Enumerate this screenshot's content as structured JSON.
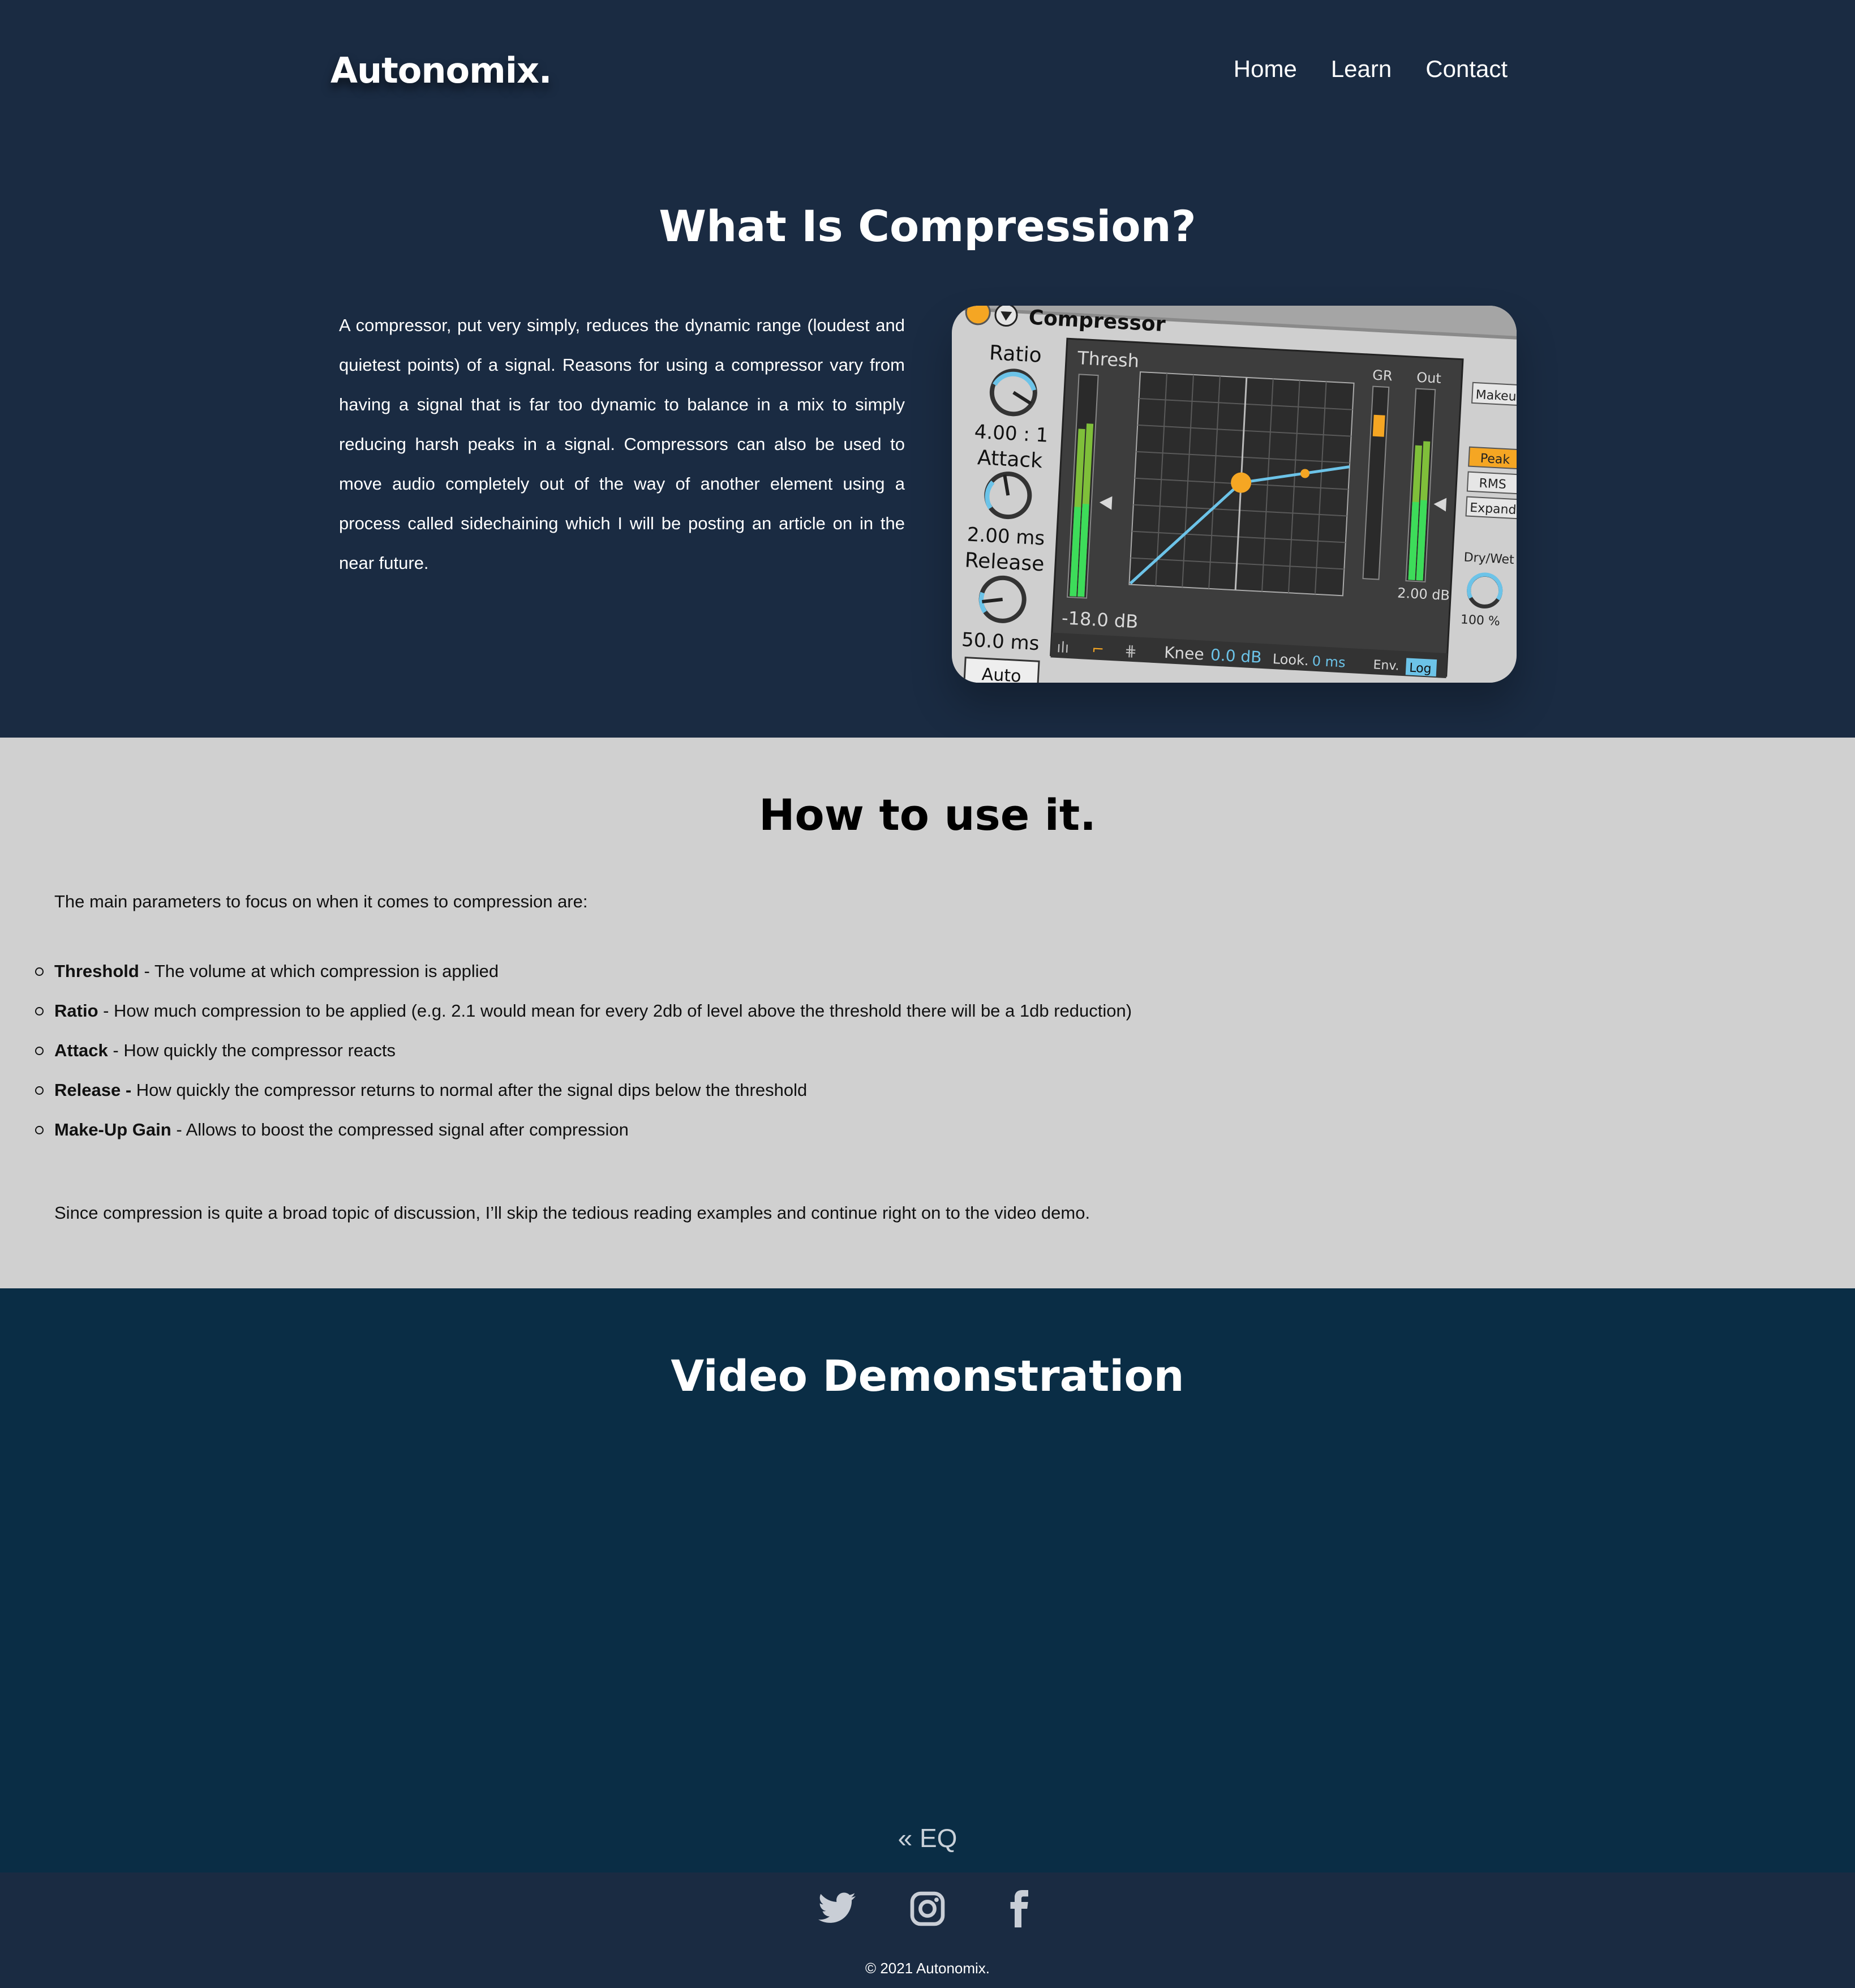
{
  "brand": {
    "logo": "Autonomix."
  },
  "nav": {
    "items": [
      "Home",
      "Learn",
      "Contact"
    ]
  },
  "hero": {
    "title": "What Is Compression?",
    "body": "A compressor, put very simply, reduces the dynamic range (loudest and quietest points) of a signal. Reasons for using a compressor vary from having a signal that is far too dynamic to balance in a mix to simply reducing harsh peaks in a signal. Compressors can also be used to move audio completely out of the way of another element using a process called sidechaining which I will be posting an article on in the near future."
  },
  "plugin": {
    "name": "Compressor",
    "ratio_label": "Ratio",
    "ratio_value": "4.00 : 1",
    "attack_label": "Attack",
    "attack_value": "2.00 ms",
    "release_label": "Release",
    "release_value": "50.0 ms",
    "auto_label": "Auto",
    "thresh_label": "Thresh",
    "thresh_value": "-18.0 dB",
    "gr_label": "GR",
    "out_label": "Out",
    "out_value": "2.00 dB",
    "makeup_label": "Makeup",
    "peak_label": "Peak",
    "rms_label": "RMS",
    "expand_label": "Expand",
    "drywet_label": "Dry/Wet",
    "drywet_value": "100 %",
    "knee_label": "Knee",
    "knee_value": "0.0 dB",
    "look_label": "Look.",
    "look_value": "0 ms",
    "env_label": "Env.",
    "env_value": "Log",
    "colors": {
      "accent": "#f5a623",
      "meter": "#3ddc5a",
      "curve": "#6cc3e8"
    }
  },
  "how": {
    "title": "How to use it.",
    "intro": "The main parameters to focus on when it comes to compression are:",
    "params": [
      {
        "term": "Threshold",
        "desc": " - The volume at which compression is applied"
      },
      {
        "term": "Ratio",
        "desc": " - How much compression to be applied (e.g. 2.1 would mean for every 2db of level above the threshold there will be a 1db reduction)"
      },
      {
        "term": "Attack",
        "desc": " - How quickly the compressor reacts"
      },
      {
        "term": "Release -",
        "desc": " How quickly the compressor returns to normal after the signal dips below the threshold"
      },
      {
        "term": "Make-Up Gain",
        "desc": " - Allows to boost the compressed signal after compression"
      }
    ],
    "outro": "Since compression is quite a broad topic of discussion, I’ll skip the tedious reading examples and continue right on to the video demo."
  },
  "video": {
    "title": "Video Demonstration",
    "prev_link": "« EQ"
  },
  "footer": {
    "socials": [
      "twitter-icon",
      "instagram-icon",
      "facebook-icon"
    ],
    "copyright": "© 2021 Autonomix."
  },
  "colors": {
    "header_bg": "#1a2b42",
    "how_bg": "#d0d0d0",
    "video_bg": "#0a2d45",
    "footer_bg": "#1a2b42"
  }
}
